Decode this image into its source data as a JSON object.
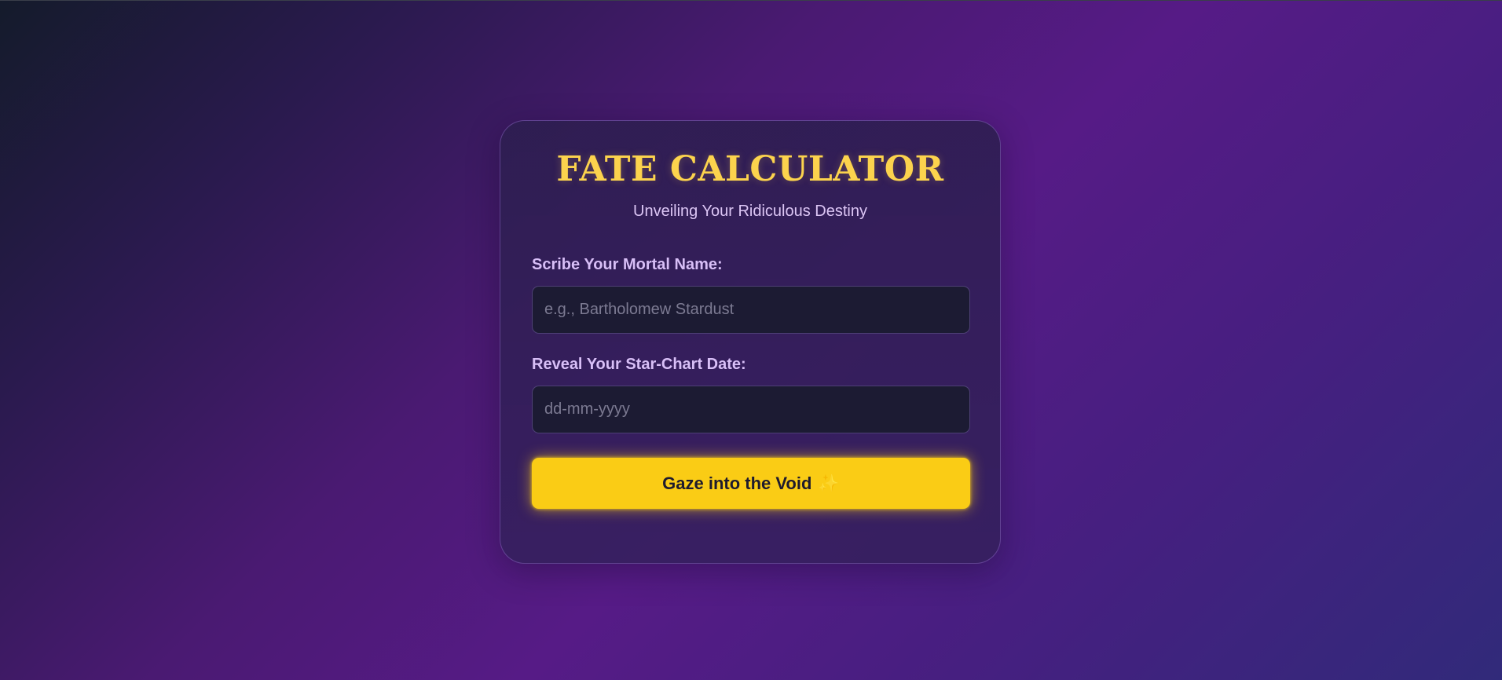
{
  "app": {
    "title": "FATE CALCULATOR",
    "subtitle": "Unveiling Your Ridiculous Destiny"
  },
  "form": {
    "name_label": "Scribe Your Mortal Name:",
    "name_placeholder": "e.g., Bartholomew Stardust",
    "name_value": "",
    "date_label": "Reveal Your Star-Chart Date:",
    "date_placeholder": "dd-mm-yyyy",
    "submit_label": "Gaze into the Void",
    "submit_icon": "✨"
  },
  "colors": {
    "accent": "#facc15",
    "title": "#fcd34d",
    "label": "#d8bff7",
    "card": "#2d1e50"
  },
  "icons": {
    "submit": "sparkles-icon"
  }
}
